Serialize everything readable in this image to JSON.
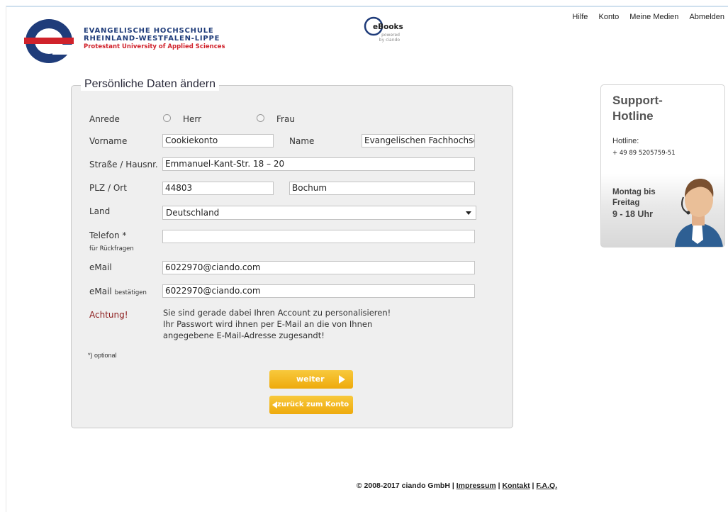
{
  "header": {
    "university_line1": "EVANGELISCHE HOCHSCHULE",
    "university_line2": "RHEINLAND-WESTFALEN-LIPPE",
    "university_line3": "Protestant University of Applied Sciences",
    "ebooks_name": "eBooks",
    "ebooks_powered": "powered by ciando",
    "nav": [
      "Hilfe",
      "Konto",
      "Meine Medien",
      "Abmelden"
    ]
  },
  "form": {
    "title": "Persönliche Daten ändern",
    "anrede_label": "Anrede",
    "anrede_options": [
      "Herr",
      "Frau"
    ],
    "vorname_label": "Vorname",
    "vorname_value": "Cookiekonto",
    "name_label": "Name",
    "name_value": "Evangelischen Fachhochsc",
    "strasse_label": "Straße / Hausnr.",
    "strasse_value": "Emmanuel-Kant-Str. 18 – 20",
    "plz_label": "PLZ / Ort",
    "plz_value": "44803",
    "ort_value": "Bochum",
    "land_label": "Land",
    "land_value": "Deutschland",
    "telefon_label": "Telefon *",
    "telefon_sub": "für Rückfragen",
    "telefon_value": "",
    "email_label": "eMail",
    "email_value": "6022970@ciando.com",
    "email_confirm_label": "eMail",
    "email_confirm_sub": "bestätigen",
    "email_confirm_value": "6022970@ciando.com",
    "achtung": "Achtung!",
    "note": "Sie sind gerade dabei Ihren Account zu personalisieren! Ihr Passwort wird ihnen per E-Mail an die von Ihnen angegebene E-Mail-Adresse zugesandt!",
    "optional": "*) optional",
    "weiter_label": "weiter",
    "back_label": "zurück zum Konto"
  },
  "support": {
    "title_line1": "Support-",
    "title_line2": "Hotline",
    "hotline_label": "Hotline:",
    "hotline_number": "+ 49 89 5205759-51",
    "days_line1": "Montag bis",
    "days_line2": "Freitag",
    "hours": "9 - 18 Uhr"
  },
  "footer": {
    "copyright": "© 2008-2017 ciando GmbH |",
    "links": [
      "Impressum",
      "Kontakt",
      "F.A.Q."
    ]
  },
  "colors": {
    "brand_red": "#d0222b",
    "brand_blue": "#1f3c7a",
    "button_yellow": "#f2b519",
    "warning_red": "#8b1a1a"
  }
}
